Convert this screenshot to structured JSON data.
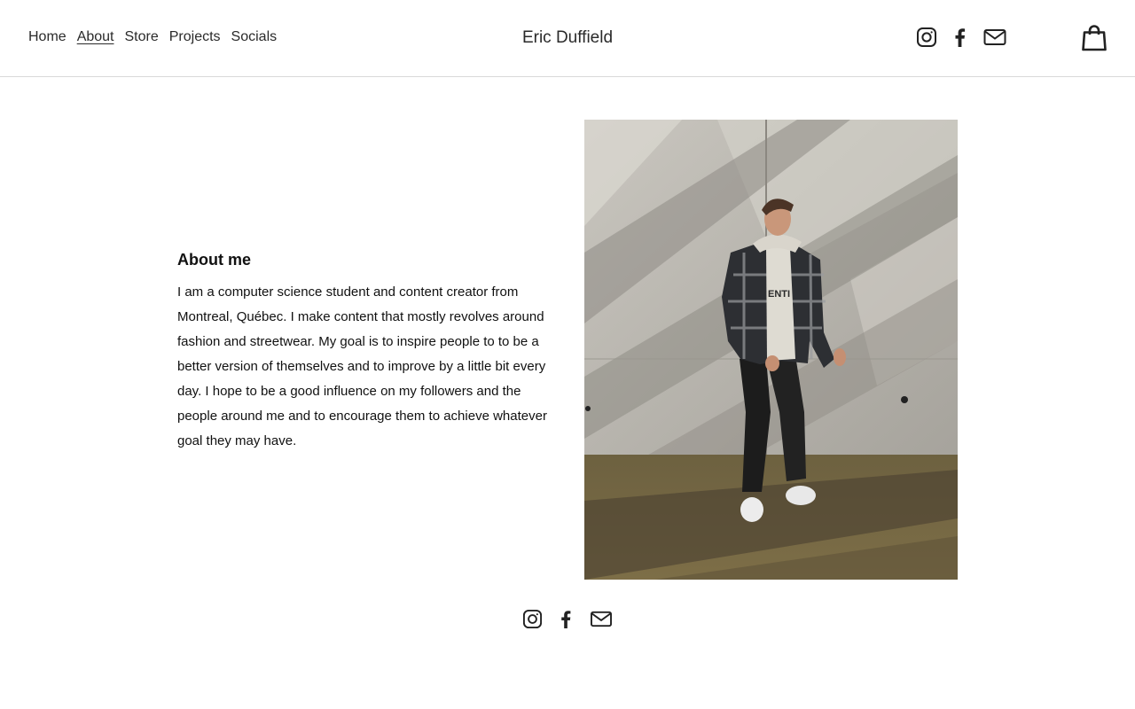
{
  "nav": {
    "items": [
      {
        "label": "Home"
      },
      {
        "label": "About",
        "active": true
      },
      {
        "label": "Store"
      },
      {
        "label": "Projects"
      },
      {
        "label": "Socials"
      }
    ]
  },
  "site": {
    "title": "Eric Duffield"
  },
  "header_icons": [
    "instagram-icon",
    "facebook-icon",
    "email-icon",
    "shopping-bag-icon"
  ],
  "about": {
    "heading": "About me",
    "body": "I am a computer science student and content creator from Montreal, Québec. I make content that mostly revolves around fashion and streetwear. My goal is to inspire people to to be a better version of themselves and to improve by a little bit every day. I hope to be a good influence on my followers and the people around me and to encourage them to achieve whatever goal they may have."
  },
  "footer_icons": [
    "instagram-icon",
    "facebook-icon",
    "email-icon"
  ],
  "colors": {
    "text": "#2a2a2a",
    "divider": "#d9d9d9",
    "background": "#ffffff"
  }
}
